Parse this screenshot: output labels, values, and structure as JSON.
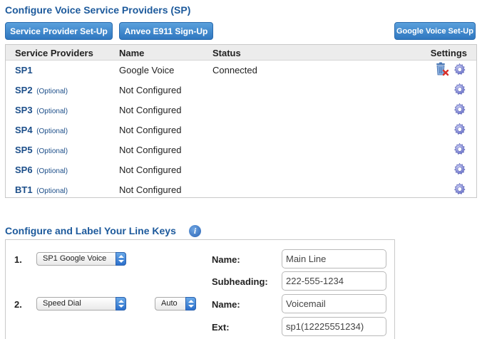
{
  "sp_section": {
    "title": "Configure Voice Service Providers (SP)",
    "buttons": {
      "setup": "Service Provider Set-Up",
      "anveo": "Anveo E911 Sign-Up",
      "google": "Google Voice Set-Up"
    },
    "columns": {
      "providers": "Service Providers",
      "name": "Name",
      "status": "Status",
      "settings": "Settings"
    },
    "rows": [
      {
        "id": "SP1",
        "optional": "",
        "name": "Google Voice",
        "status": "Connected",
        "has_delete": true
      },
      {
        "id": "SP2",
        "optional": "(Optional)",
        "name": "Not Configured",
        "status": "",
        "has_delete": false
      },
      {
        "id": "SP3",
        "optional": "(Optional)",
        "name": "Not Configured",
        "status": "",
        "has_delete": false
      },
      {
        "id": "SP4",
        "optional": "(Optional)",
        "name": "Not Configured",
        "status": "",
        "has_delete": false
      },
      {
        "id": "SP5",
        "optional": "(Optional)",
        "name": "Not Configured",
        "status": "",
        "has_delete": false
      },
      {
        "id": "SP6",
        "optional": "(Optional)",
        "name": "Not Configured",
        "status": "",
        "has_delete": false
      },
      {
        "id": "BT1",
        "optional": "(Optional)",
        "name": "Not Configured",
        "status": "",
        "has_delete": false
      }
    ],
    "icons": {
      "settings": "gear-icon",
      "delete": "trash-delete-icon"
    }
  },
  "line_keys": {
    "title": "Configure and Label Your Line Keys",
    "info_icon": "info-icon",
    "info_glyph": "i",
    "keys": [
      {
        "number": "1.",
        "select_value": "SP1 Google Voice",
        "fields": [
          {
            "label": "Name:",
            "value": "Main Line"
          },
          {
            "label": "Subheading:",
            "value": "222-555-1234"
          }
        ]
      },
      {
        "number": "2.",
        "select_value": "Speed Dial",
        "mode_value": "Auto",
        "fields": [
          {
            "label": "Name:",
            "value": "Voicemail"
          },
          {
            "label": "Ext:",
            "value": "sp1(12225551234)"
          }
        ]
      }
    ]
  },
  "colors": {
    "title_blue": "#1d5a9c",
    "button_blue": "#2f77c0",
    "gear_purple": "#7f86d6",
    "delete_red": "#d9302a"
  }
}
